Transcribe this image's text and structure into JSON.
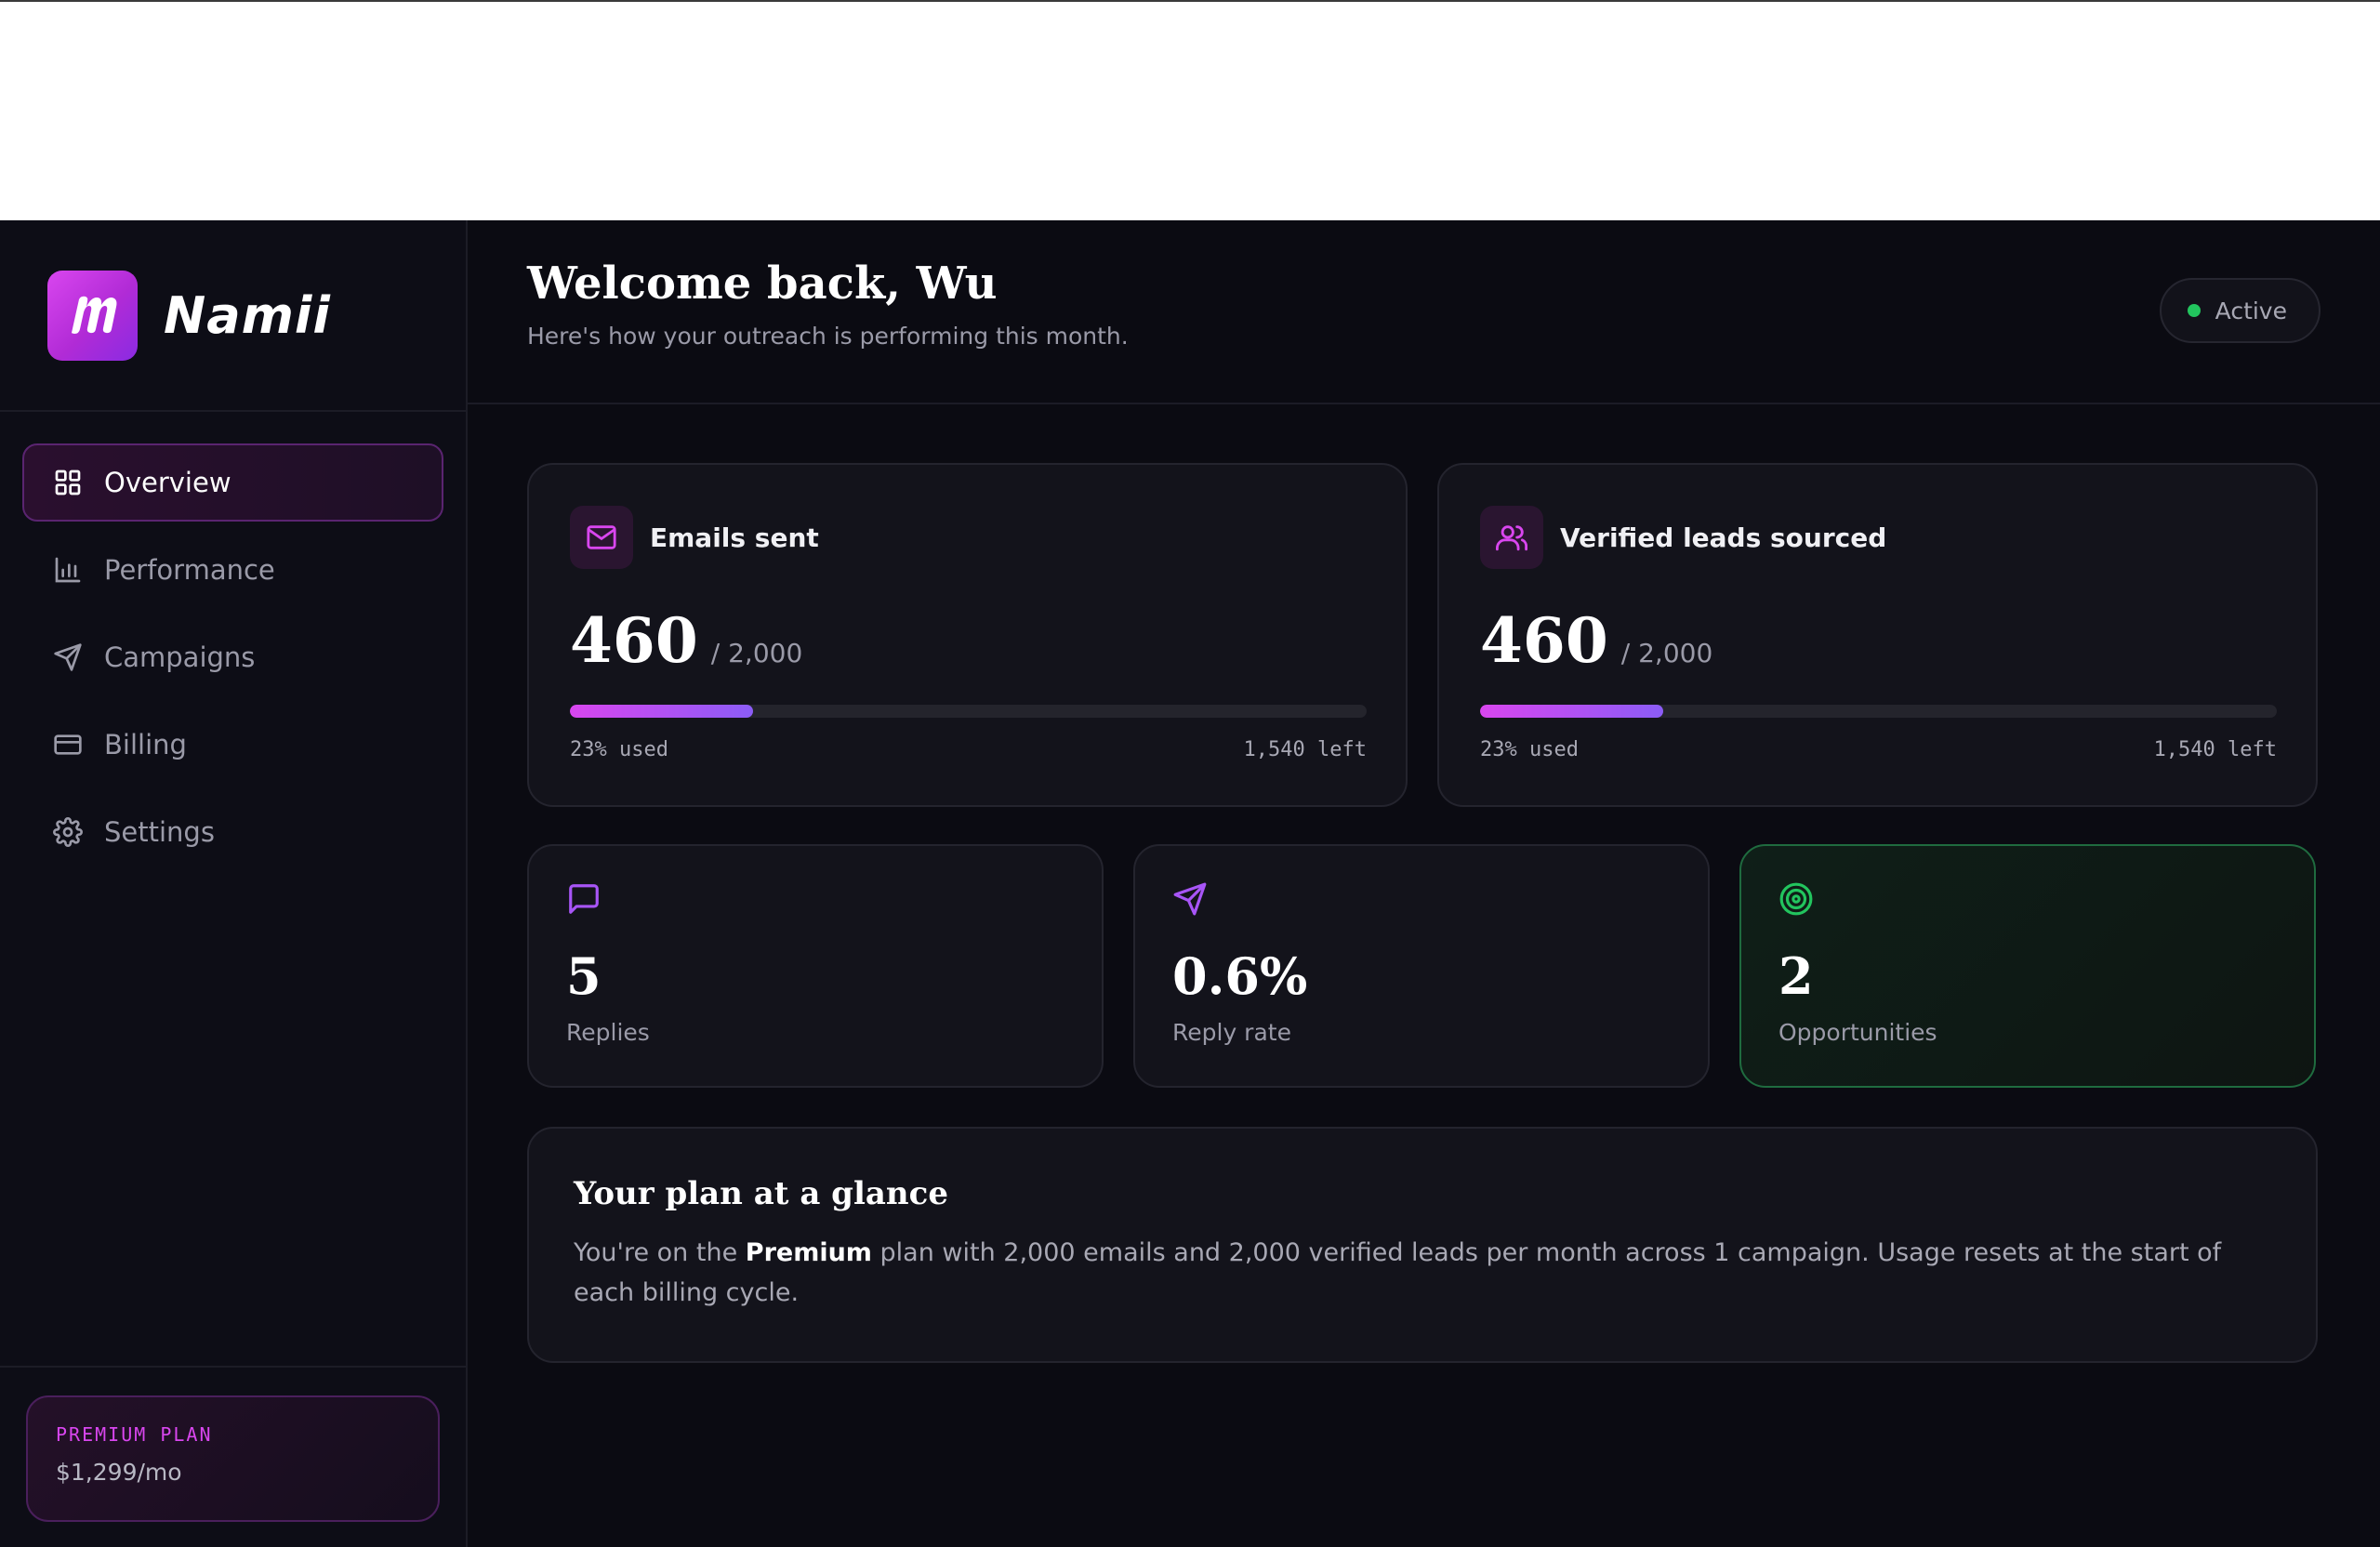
{
  "brand": {
    "name": "Namii",
    "logo_glyph": "m",
    "accent": "#d946ef"
  },
  "nav": [
    {
      "label": "Overview",
      "icon": "grid-icon",
      "active": true
    },
    {
      "label": "Performance",
      "icon": "bar-chart-icon",
      "active": false
    },
    {
      "label": "Campaigns",
      "icon": "send-icon",
      "active": false
    },
    {
      "label": "Billing",
      "icon": "credit-card-icon",
      "active": false
    },
    {
      "label": "Settings",
      "icon": "gear-icon",
      "active": false
    }
  ],
  "plan": {
    "label": "PREMIUM PLAN",
    "price": "$1,299/mo"
  },
  "header": {
    "title": "Welcome back, Wu",
    "subtitle": "Here's how your outreach is performing this month.",
    "status": "Active",
    "status_color": "#22c55e"
  },
  "usage": [
    {
      "title": "Emails sent",
      "icon": "mail-icon",
      "value": "460",
      "total": "/ 2,000",
      "progress": 0.23,
      "used_label": "23% used",
      "left_label": "1,540 left"
    },
    {
      "title": "Verified leads sourced",
      "icon": "users-icon",
      "value": "460",
      "total": "/ 2,000",
      "progress": 0.23,
      "used_label": "23% used",
      "left_label": "1,540 left"
    }
  ],
  "stats": [
    {
      "value": "5",
      "label": "Replies",
      "icon": "message-icon"
    },
    {
      "value": "0.6%",
      "label": "Reply rate",
      "icon": "send-icon"
    },
    {
      "value": "2",
      "label": "Opportunities",
      "icon": "target-icon"
    }
  ],
  "glance": {
    "title": "Your plan at a glance",
    "text_before": "You're on the ",
    "plan_name": "Premium",
    "text_after": " plan with 2,000 emails and 2,000 verified leads per month across 1 campaign. Usage resets at the start of each billing cycle."
  }
}
